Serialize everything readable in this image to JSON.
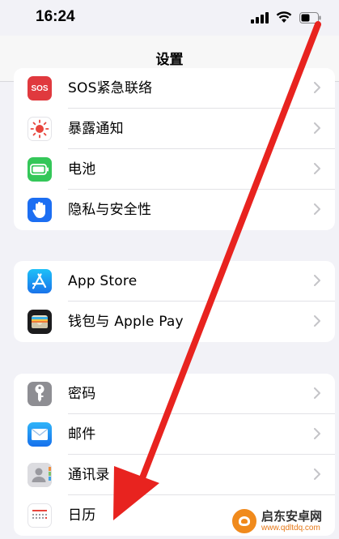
{
  "status_bar": {
    "time": "16:24"
  },
  "nav": {
    "title": "设置"
  },
  "groups": [
    {
      "rows": [
        {
          "label": "SOS紧急联络",
          "icon": "sos-icon",
          "color": "#e0393e"
        },
        {
          "label": "暴露通知",
          "icon": "exposure-notification-icon",
          "color": "#ffffff"
        },
        {
          "label": "电池",
          "icon": "battery-icon",
          "color": "#34c759"
        },
        {
          "label": "隐私与安全性",
          "icon": "privacy-hand-icon",
          "color": "#1c6ef2"
        }
      ]
    },
    {
      "rows": [
        {
          "label": "App Store",
          "icon": "app-store-icon",
          "color": "#1a8cf5"
        },
        {
          "label": "钱包与 Apple Pay",
          "icon": "wallet-icon",
          "color": "#1c1c1e"
        }
      ]
    },
    {
      "rows": [
        {
          "label": "密码",
          "icon": "key-icon",
          "color": "#8e8e93"
        },
        {
          "label": "邮件",
          "icon": "mail-icon",
          "color": "#1a8cf5"
        },
        {
          "label": "通讯录",
          "icon": "contacts-icon",
          "color": "#d8d8dc"
        },
        {
          "label": "日历",
          "icon": "calendar-icon",
          "color": "#ffffff"
        }
      ]
    }
  ],
  "sos_icon_text": "SOS",
  "watermark": {
    "name": "启东安卓网",
    "url": "www.qdltdq.com"
  },
  "colors": {
    "arrow": "#e8231f",
    "background": "#f2f2f7",
    "chevron": "#c4c4c8"
  }
}
